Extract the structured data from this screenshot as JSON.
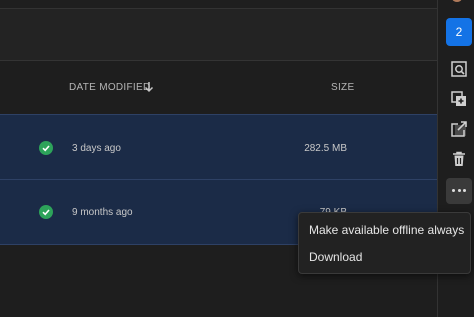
{
  "table": {
    "headers": {
      "date_modified": "DATE MODIFIED",
      "size": "SIZE"
    },
    "sort_icon": "arrow-down-icon",
    "rows": [
      {
        "status_icon": "check-circle-icon",
        "date_modified": "3 days ago",
        "size": "282.5 MB"
      },
      {
        "status_icon": "check-circle-icon",
        "date_modified": "9 months ago",
        "size": "79 KB"
      }
    ]
  },
  "side_panel": {
    "selection_count": "2",
    "icons": [
      "preview-search-icon",
      "duplicate-add-icon",
      "share-export-icon",
      "trash-icon",
      "more-icon"
    ]
  },
  "context_menu": {
    "items": [
      "Make available offline always",
      "Download"
    ]
  },
  "colors": {
    "selected_row": "#1b2b47",
    "accent": "#1473e6",
    "check": "#2da35a",
    "background": "#1e1e1e"
  }
}
